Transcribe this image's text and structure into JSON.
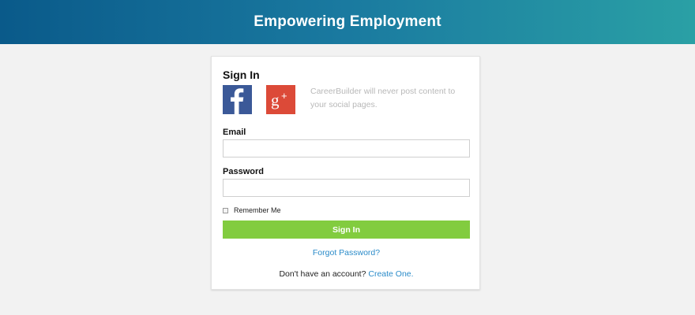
{
  "header": {
    "title": "Empowering Employment"
  },
  "signin": {
    "title": "Sign In",
    "social_note": "CareerBuilder will never post content to your social pages.",
    "social": [
      {
        "name": "facebook",
        "icon": "facebook-icon",
        "color": "#3b5998"
      },
      {
        "name": "google-plus",
        "icon": "google-plus-icon",
        "color": "#dc4a38"
      }
    ],
    "email_label": "Email",
    "email_value": "",
    "password_label": "Password",
    "password_value": "",
    "remember_label": "Remember Me",
    "remember_checked": false,
    "button_label": "Sign In",
    "button_color": "#82cc3f",
    "forgot_label": "Forgot Password?",
    "no_account_text": "Don't have an account?",
    "create_label": "Create One."
  },
  "colors": {
    "header_start": "#0a5a8a",
    "header_end": "#2aa0a5",
    "link": "#2a8bc9",
    "background": "#f2f2f2"
  }
}
